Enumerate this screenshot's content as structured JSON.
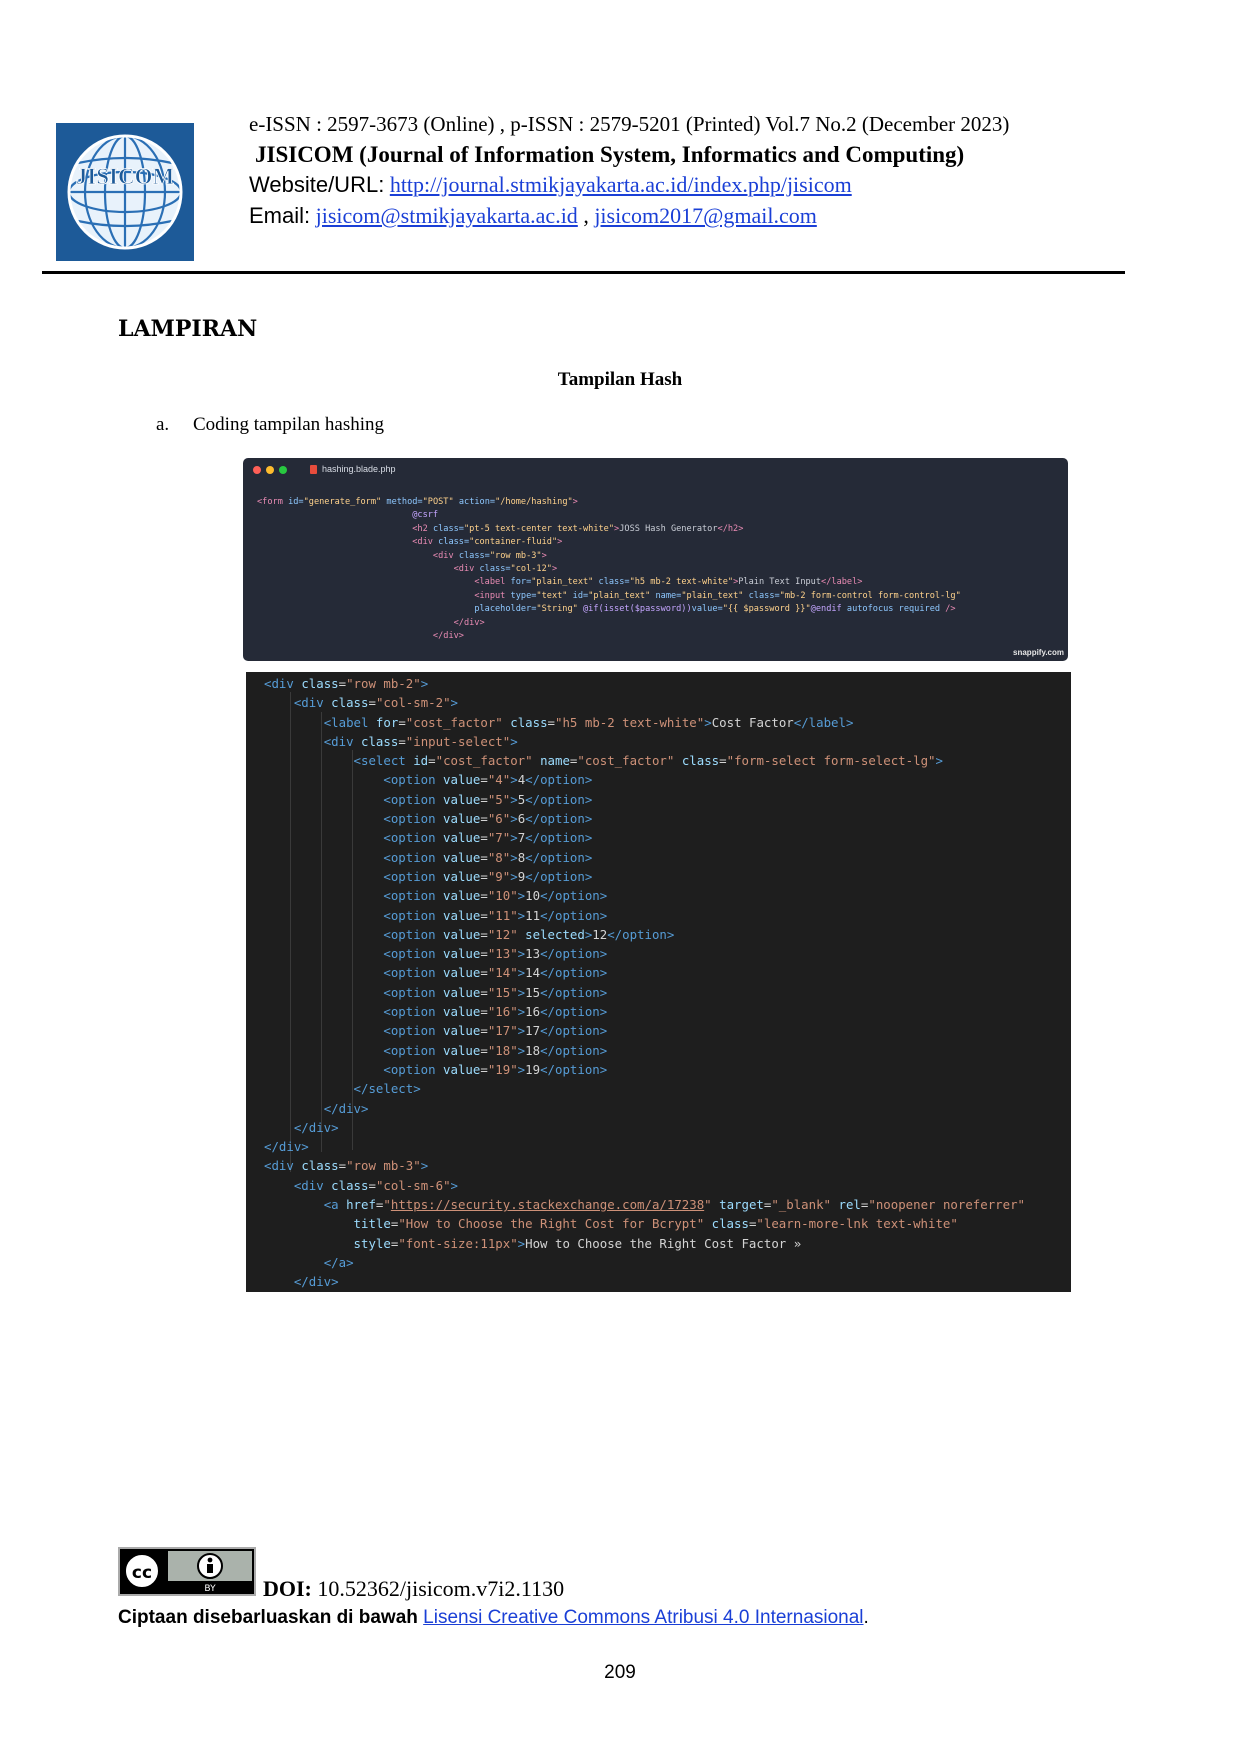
{
  "header": {
    "issn_line": "e-ISSN : 2597-3673 (Online) , p-ISSN : 2579-5201 (Printed) Vol.7 No.2  (December 2023)",
    "journal_short": "JISICOM",
    "journal_full": "(Journal of Information System, Informatics and Computing)",
    "website_label": "Website/URL:",
    "website_url": "http://journal.stmikjayakarta.ac.id/index.php/jisicom",
    "email_label": "Email:",
    "email_1": "jisicom@stmikjayakarta.ac.id",
    "email_sep": ",",
    "email_2": "jisicom2017@gmail.com",
    "logo_text": "JISICOM"
  },
  "body": {
    "section_heading": "LAMPIRAN",
    "figure_title": "Tampilan Hash",
    "item_label": "a.",
    "item_text": "Coding tampilan hashing"
  },
  "snippet_1": {
    "filename": "hashing.blade.php",
    "brand": "snappify.com"
  },
  "footer": {
    "doi_label": "DOI:",
    "doi_value": "10.52362/jisicom.v7i2.1130",
    "license_prefix": "Ciptaan disebarluaskan di bawah",
    "license_link": "Lisensi Creative Commons Atribusi 4.0 Internasional",
    "license_suffix": ".",
    "cc_by": "BY",
    "page_number": "209"
  },
  "colors": {
    "logo_blue": "#1d5a98",
    "link_blue": "#1a3fd6",
    "snippet_bg": "#252a37",
    "editor_bg": "#1e1e1e"
  }
}
